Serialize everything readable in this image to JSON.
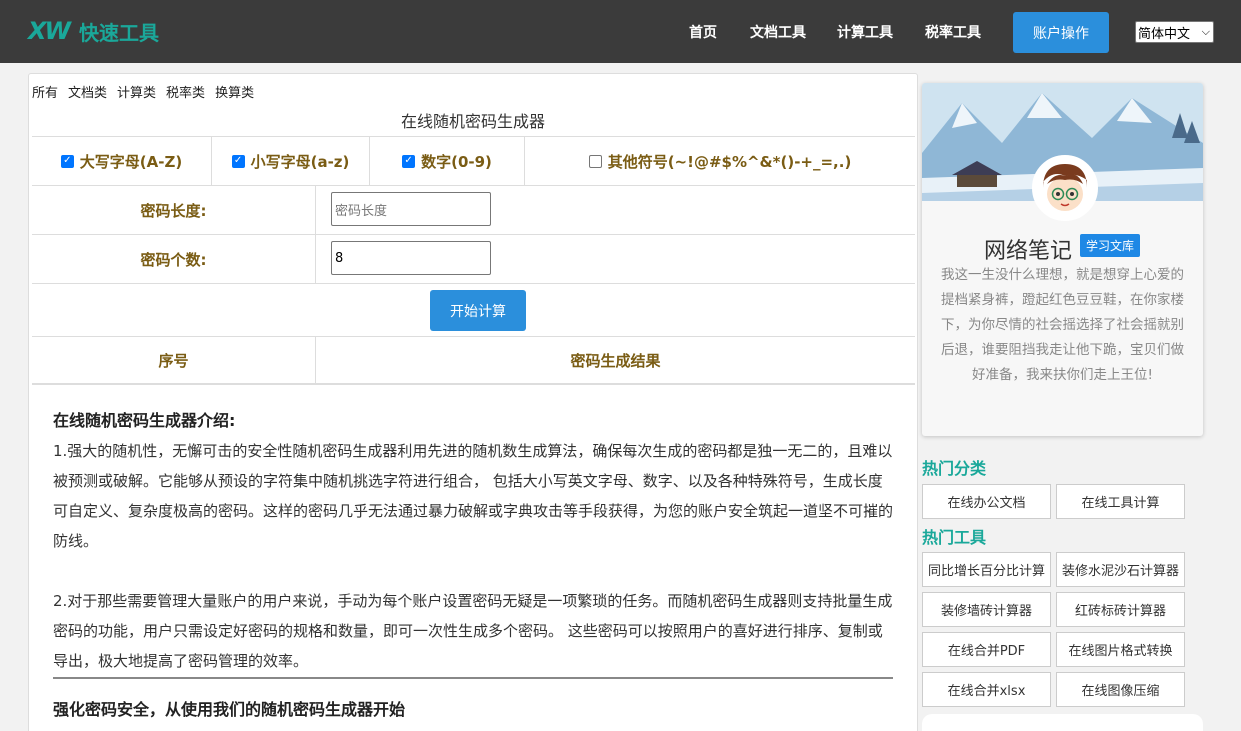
{
  "header": {
    "logo_mark": "XW",
    "logo_text": "快速工具",
    "nav": [
      "首页",
      "文档工具",
      "计算工具",
      "税率工具"
    ],
    "account_label": "账户操作",
    "language": "简体中文"
  },
  "categories": [
    "所有",
    "文档类",
    "计算类",
    "税率类",
    "换算类"
  ],
  "tool": {
    "title": "在线随机密码生成器",
    "options": [
      {
        "label": "大写字母(A-Z)",
        "checked": true
      },
      {
        "label": "小写字母(a-z)",
        "checked": true
      },
      {
        "label": "数字(0-9)",
        "checked": true
      },
      {
        "label": "其他符号(~!@#$%^&*()-+_=,.)",
        "checked": false
      }
    ],
    "length_label": "密码长度:",
    "length_placeholder": "密码长度",
    "count_label": "密码个数:",
    "count_value": "8",
    "calc_button": "开始计算",
    "col_index": "序号",
    "col_result": "密码生成结果"
  },
  "intro": {
    "heading": "在线随机密码生成器介绍:",
    "para1": "1.强大的随机性，无懈可击的安全性随机密码生成器利用先进的随机数生成算法，确保每次生成的密码都是独一无二的，且难以被预测或破解。它能够从预设的字符集中随机挑选字符进行组合， 包括大小写英文字母、数字、以及各种特殊符号，生成长度可自定义、复杂度极高的密码。这样的密码几乎无法通过暴力破解或字典攻击等手段获得，为您的账户安全筑起一道坚不可摧的防线。",
    "para2": "2.对于那些需要管理大量账户的用户来说，手动为每个账户设置密码无疑是一项繁琐的任务。而随机密码生成器则支持批量生成密码的功能，用户只需设定好密码的规格和数量，即可一次性生成多个密码。 这些密码可以按照用户的喜好进行排序、复制或导出，极大地提高了密码管理的效率。",
    "subheading": "强化密码安全，从使用我们的随机密码生成器开始"
  },
  "profile": {
    "name": "网络笔记",
    "tag": "学习文库",
    "description": "我这一生没什么理想，就是想穿上心爱的提档紧身裤，蹬起红色豆豆鞋，在你家楼下，为你尽情的社会摇选择了社会摇就别后退，谁要阻挡我走让他下跪，宝贝们做好准备，我来扶你们走上王位!"
  },
  "hot_categories": {
    "title": "热门分类",
    "items": [
      "在线办公文档",
      "在线工具计算"
    ]
  },
  "hot_tools": {
    "title": "热门工具",
    "items": [
      "同比增长百分比计算",
      "装修水泥沙石计算器",
      "装修墙砖计算器",
      "红砖标砖计算器",
      "在线合并PDF",
      "在线图片格式转换",
      "在线合并xlsx",
      "在线图像压缩"
    ]
  },
  "colors": {
    "topbar": "#3b3b3b",
    "accent_teal": "#1aa89a",
    "button_blue": "#2b8fdc",
    "label_brown": "#7a5c14"
  }
}
